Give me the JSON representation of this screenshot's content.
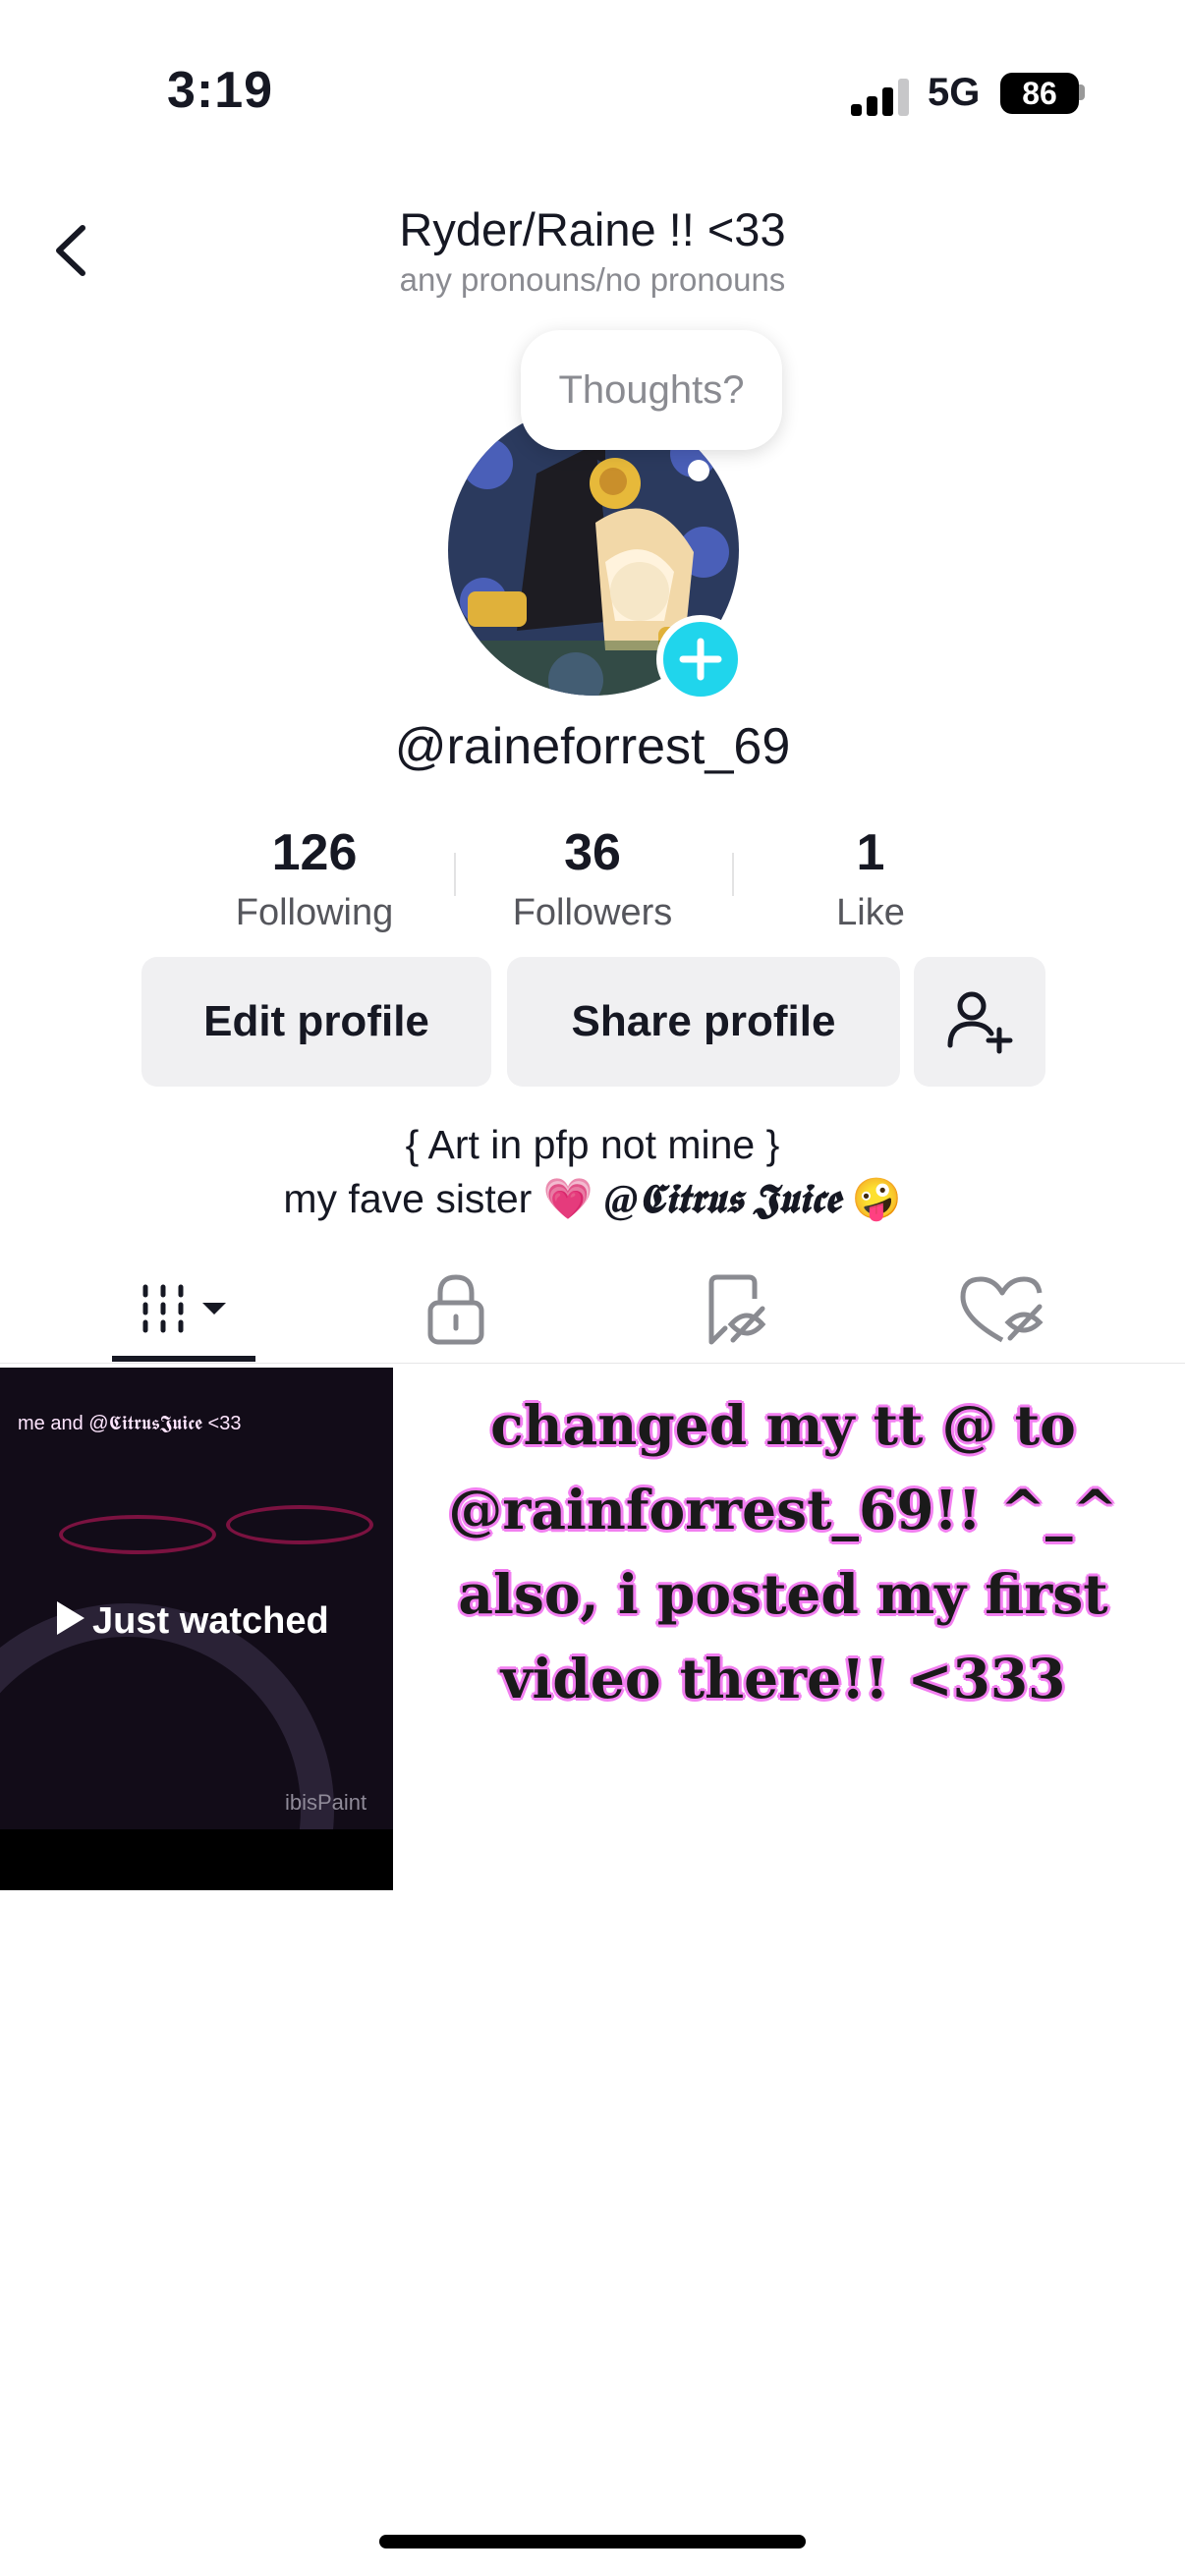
{
  "status_bar": {
    "time": "3:19",
    "network": "5G",
    "battery": "86"
  },
  "header": {
    "title": "Ryder/Raine !! <33",
    "subtitle": "any pronouns/no pronouns"
  },
  "avatar": {
    "bubble_text": "Thoughts?"
  },
  "profile": {
    "handle": "@raineforrest_69"
  },
  "stats": [
    {
      "value": "126",
      "label": "Following"
    },
    {
      "value": "36",
      "label": "Followers"
    },
    {
      "value": "1",
      "label": "Like"
    }
  ],
  "buttons": {
    "edit": "Edit profile",
    "share": "Share profile"
  },
  "bio": {
    "line1": "{ Art in pfp not mine }",
    "line2_prefix": "my fave sister",
    "heart": "💗",
    "mention": "@𝕮𝖎𝖙𝖗𝖚𝖘 𝕵𝖚𝖎𝖈𝖊",
    "emoji": "🤪"
  },
  "tabs": [
    "videos-grid",
    "private",
    "reposts-hidden",
    "liked-hidden"
  ],
  "videos": [
    {
      "overlay_top": "me and @𝕮𝖎𝖙𝖗𝖚𝖘𝕵𝖚𝖎𝖈𝖊 <33",
      "badge": "Just watched",
      "watermark": "ibisPaint"
    }
  ],
  "announcement": "changed my tt @ to @rainforrest_69!! ^_^ also, i posted my first video there!! <333",
  "colors": {
    "accent": "#20d5ec",
    "heart": "#f23aa5",
    "announce_outline": "#f27ff0"
  }
}
